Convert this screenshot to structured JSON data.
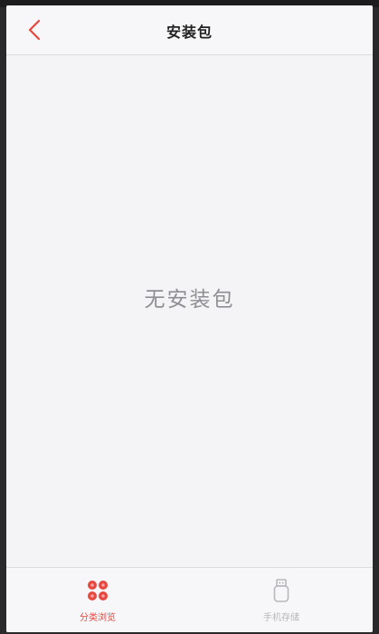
{
  "nav": {
    "title": "安装包",
    "back_icon": "chevron-left-icon"
  },
  "content": {
    "empty_message": "无安装包"
  },
  "tabs": [
    {
      "label": "分类浏览",
      "icon": "grid-dots-icon",
      "active": true
    },
    {
      "label": "手机存储",
      "icon": "usb-drive-icon",
      "active": false
    }
  ],
  "colors": {
    "accent": "#e8463e",
    "inactive": "#b8b8bc",
    "background": "#f4f4f6"
  }
}
